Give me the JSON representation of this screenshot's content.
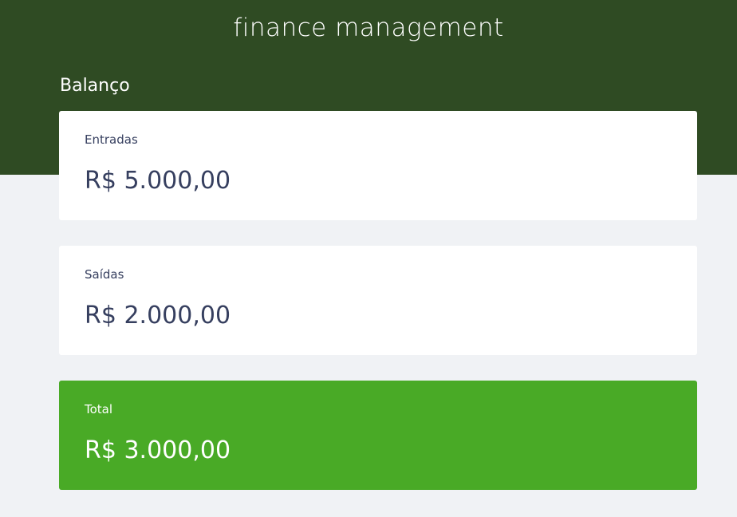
{
  "app": {
    "title": "finance management"
  },
  "balance": {
    "heading": "Balanço",
    "cards": [
      {
        "label": "Entradas",
        "value": "R$ 5.000,00"
      },
      {
        "label": "Saídas",
        "value": "R$ 2.000,00"
      },
      {
        "label": "Total",
        "value": "R$ 3.000,00"
      }
    ]
  },
  "colors": {
    "header_bg": "#2f4b23",
    "page_bg": "#f0f2f5",
    "card_bg": "#ffffff",
    "total_bg": "#49aa26",
    "text_dark": "#363f5f"
  }
}
